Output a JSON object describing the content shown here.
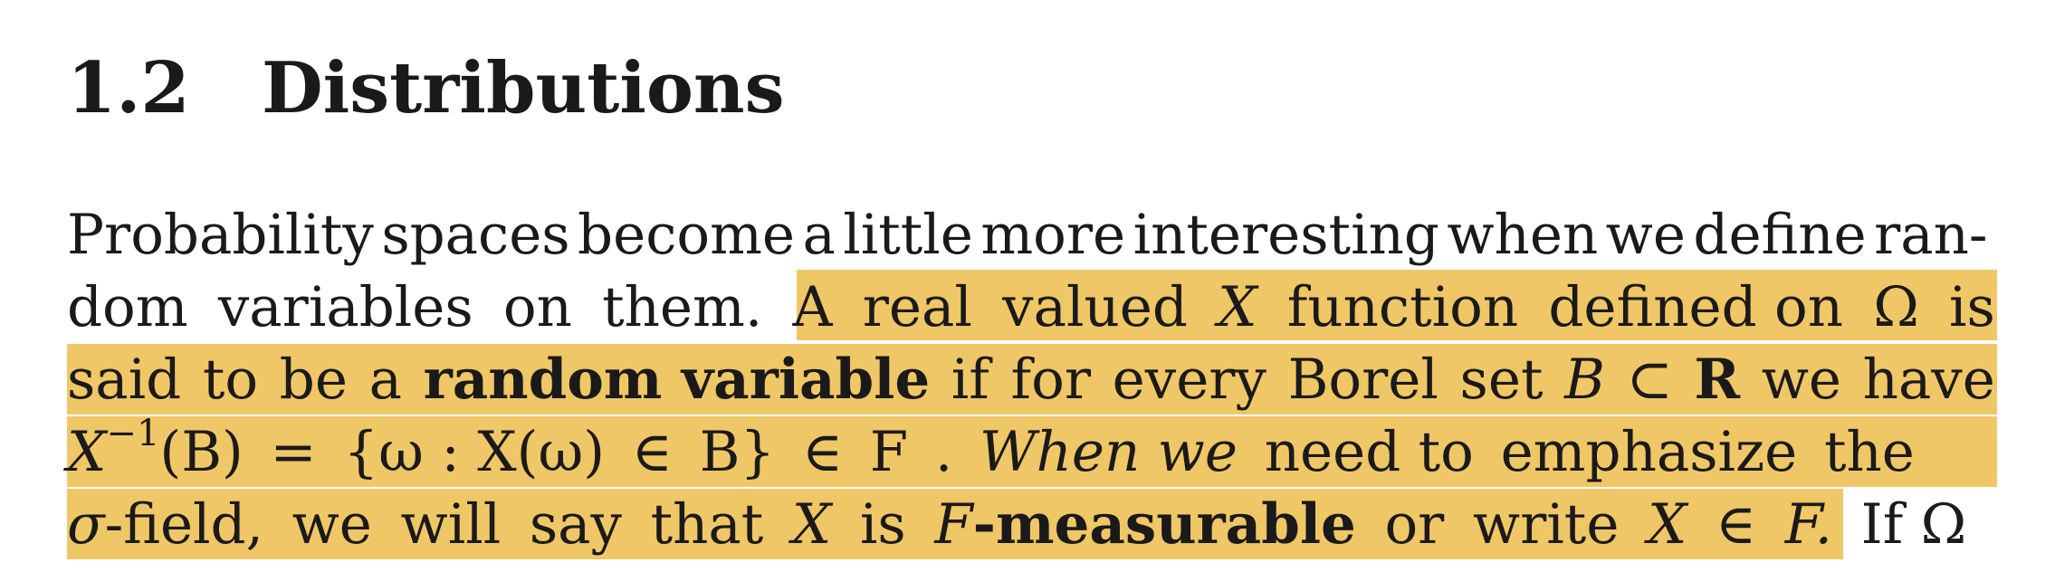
{
  "section": {
    "number": "1.2",
    "title": "Distributions"
  },
  "lines": [
    [
      "Probability",
      "spaces",
      "become",
      "a",
      "little",
      "more",
      "interesting",
      "when",
      "we",
      "define",
      "ran-",
      ""
    ],
    [
      "dom",
      "variables",
      "on",
      "them.",
      "A",
      "real",
      "valued",
      "X",
      "function",
      "defined on",
      "Ω",
      "is"
    ],
    [
      "said",
      "to",
      "be",
      "a",
      "random variable",
      "if",
      "for",
      "every",
      "Borel",
      "set",
      "B",
      "⊂",
      "R",
      "we",
      "have"
    ],
    [
      "X",
      "−1",
      "(B)",
      "=",
      "{ω : X(ω)",
      "∈",
      "B}",
      "∈",
      "F",
      ".",
      "When we",
      "need to",
      "emphasize",
      "the",
      "",
      ""
    ],
    [
      "σ",
      "-field,",
      "we",
      "will",
      "say",
      "that",
      "X",
      "is",
      "F",
      "-measurable",
      "or",
      "write",
      "X",
      "∈",
      "F.",
      "If Ω"
    ]
  ],
  "highlight_color": "#f0c766"
}
